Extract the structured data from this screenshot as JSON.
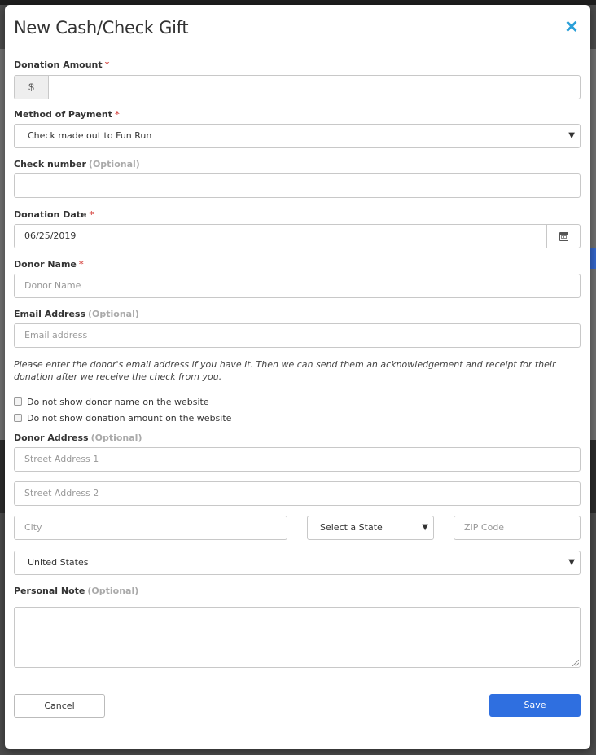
{
  "modal": {
    "title": "New Cash/Check Gift",
    "close_icon": "×"
  },
  "fields": {
    "donation_amount": {
      "label": "Donation Amount",
      "required": "*",
      "addon": "$",
      "value": ""
    },
    "method_of_payment": {
      "label": "Method of Payment",
      "required": "*",
      "selected": "Check made out to Fun Run"
    },
    "check_number": {
      "label": "Check number",
      "optional": "(Optional)",
      "value": ""
    },
    "donation_date": {
      "label": "Donation Date",
      "required": "*",
      "value": "06/25/2019",
      "icon": "calendar-icon"
    },
    "donor_name": {
      "label": "Donor Name",
      "required": "*",
      "placeholder": "Donor Name"
    },
    "email_address": {
      "label": "Email Address",
      "optional": "(Optional)",
      "placeholder": "Email address"
    },
    "email_help": "Please enter the donor's email address if you have it. Then we can send them an acknowledgement and receipt for their donation after we receive the check from you.",
    "hide_name": {
      "label": "Do not show donor name on the website",
      "checked": false
    },
    "hide_amount": {
      "label": "Do not show donation amount on the website",
      "checked": false
    },
    "donor_address": {
      "label": "Donor Address",
      "optional": "(Optional)",
      "street1_placeholder": "Street Address 1",
      "street2_placeholder": "Street Address 2",
      "city_placeholder": "City",
      "state_selected": "Select a State",
      "zip_placeholder": "ZIP Code",
      "country_selected": "United States"
    },
    "personal_note": {
      "label": "Personal Note",
      "optional": "(Optional)",
      "value": ""
    }
  },
  "buttons": {
    "cancel": "Cancel",
    "save": "Save"
  },
  "colors": {
    "accent": "#2f6fe0",
    "close": "#2a9fd8",
    "required": "#d9534f"
  }
}
